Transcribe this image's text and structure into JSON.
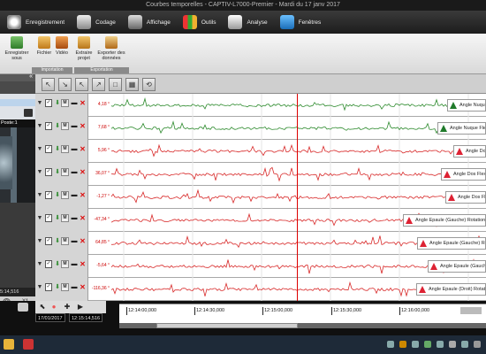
{
  "window": {
    "title": "Courbes temporelles - CAPTIV-L7000-Premier - Mardi du 17 janv 2017"
  },
  "menubar": {
    "items": [
      {
        "label": "Enregistrement",
        "icon": "record-icon",
        "color": "#ddd"
      },
      {
        "label": "Codage",
        "icon": "coding-icon",
        "color": "#ddd"
      },
      {
        "label": "Affichage",
        "icon": "display-icon",
        "color": "#ddd"
      },
      {
        "label": "Outils",
        "icon": "tools-icon",
        "color": "#f0b030"
      },
      {
        "label": "Analyse",
        "icon": "analysis-icon",
        "color": "#ccc"
      },
      {
        "label": "Fenêtres",
        "icon": "windows-icon",
        "color": "#2f8fd8"
      }
    ]
  },
  "ribbon": {
    "buttons": [
      {
        "label": "Enregistrer sous",
        "icon": "save-as-icon"
      },
      {
        "label": "Fichier",
        "icon": "file-icon"
      },
      {
        "label": "Vidéo",
        "icon": "video-icon"
      },
      {
        "label": "Extraire projet",
        "icon": "extract-project-icon"
      },
      {
        "label": "Exporter des données",
        "icon": "export-data-icon"
      }
    ],
    "groups": [
      {
        "label": "Importation"
      },
      {
        "label": "Exportation"
      }
    ]
  },
  "left_panel": {
    "poste": "Poste:1",
    "time": "5:14,516",
    "collapse": "«",
    "close": "X1"
  },
  "toolstrip": {
    "tools": [
      {
        "glyph": "↖",
        "icon": "arrow-tool-icon"
      },
      {
        "glyph": "↘",
        "icon": "arrow-tool-2-icon"
      },
      {
        "glyph": "↖",
        "icon": "arrow-tool-3-icon"
      },
      {
        "glyph": "↗",
        "icon": "arrow-tool-4-icon"
      },
      {
        "glyph": "□",
        "icon": "frame-tool-icon"
      },
      {
        "glyph": "▦",
        "icon": "grid-tool-icon"
      },
      {
        "glyph": "⟲",
        "icon": "refresh-tool-icon"
      }
    ]
  },
  "tracks": [
    {
      "value": "4,18 °",
      "label": "Angle Nuque Flexion",
      "color": "#2e8b2e"
    },
    {
      "value": "7,68 °",
      "label": "Angle Nuque Flexion",
      "color": "#2e8b2e"
    },
    {
      "value": "5,96 °",
      "label": "Angle Dos Flexion",
      "color": "#d82a2a"
    },
    {
      "value": "36,07 °",
      "label": "Angle Dos Flexion",
      "color": "#d82a2a"
    },
    {
      "value": "-1,27 °",
      "label": "Angle Dos Flexion",
      "color": "#d82a2a"
    },
    {
      "value": "-47,34 °",
      "label": "Angle Epaule (Gauche) Rotation",
      "color": "#d82a2a"
    },
    {
      "value": "64,85 °",
      "label": "Angle Epaule (Gauche) Rotation",
      "color": "#d82a2a"
    },
    {
      "value": "-5,64 °",
      "label": "Angle Epaule (Gauche) Abduction",
      "color": "#d82a2a"
    },
    {
      "value": "-116,36 °",
      "label": "Angle Epaule (Droit) Rotation",
      "color": "#d82a2a"
    }
  ],
  "timeline": {
    "date": "17/01/2017",
    "current_time": "12:15:14,516",
    "ticks": [
      "12:14:00,000",
      "12:14:30,000",
      "12:15:00,000",
      "12:15:30,000",
      "12:16:00,000"
    ]
  }
}
